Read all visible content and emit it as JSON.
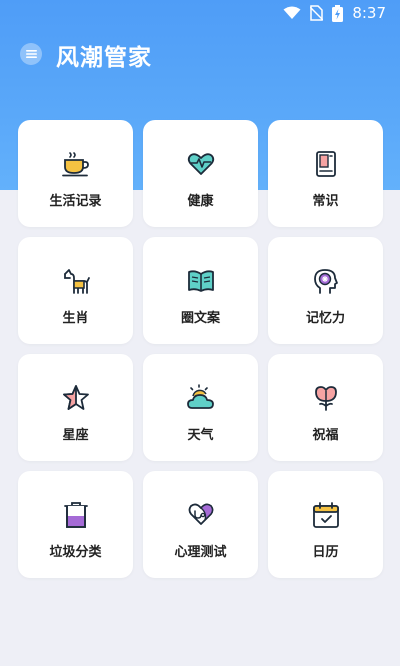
{
  "status_bar": {
    "time": "8:37",
    "icons": [
      "wifi-icon",
      "no-sim-icon",
      "battery-charging-icon"
    ]
  },
  "app_bar": {
    "title": "风潮管家",
    "menu_icon": "menu-icon"
  },
  "colors": {
    "header": "#4f9df7",
    "background": "#eeeff6",
    "card": "#ffffff",
    "icon_stroke": "#1d2b3a",
    "icon_yellow": "#f5c242",
    "icon_teal": "#5fd0c8",
    "icon_pink": "#f6a3a3",
    "icon_purple": "#a56bd6"
  },
  "cards": [
    {
      "label": "生活记录",
      "icon": "coffee-cup-icon"
    },
    {
      "label": "健康",
      "icon": "heart-pulse-icon"
    },
    {
      "label": "常识",
      "icon": "notebook-icon"
    },
    {
      "label": "生肖",
      "icon": "dog-icon"
    },
    {
      "label": "圈文案",
      "icon": "open-book-icon"
    },
    {
      "label": "记忆力",
      "icon": "brain-head-icon"
    },
    {
      "label": "星座",
      "icon": "star-icon"
    },
    {
      "label": "天气",
      "icon": "sun-cloud-icon"
    },
    {
      "label": "祝福",
      "icon": "flower-icon"
    },
    {
      "label": "垃圾分类",
      "icon": "trash-bin-icon"
    },
    {
      "label": "心理测试",
      "icon": "heart-stethoscope-icon"
    },
    {
      "label": "日历",
      "icon": "calendar-icon"
    }
  ]
}
